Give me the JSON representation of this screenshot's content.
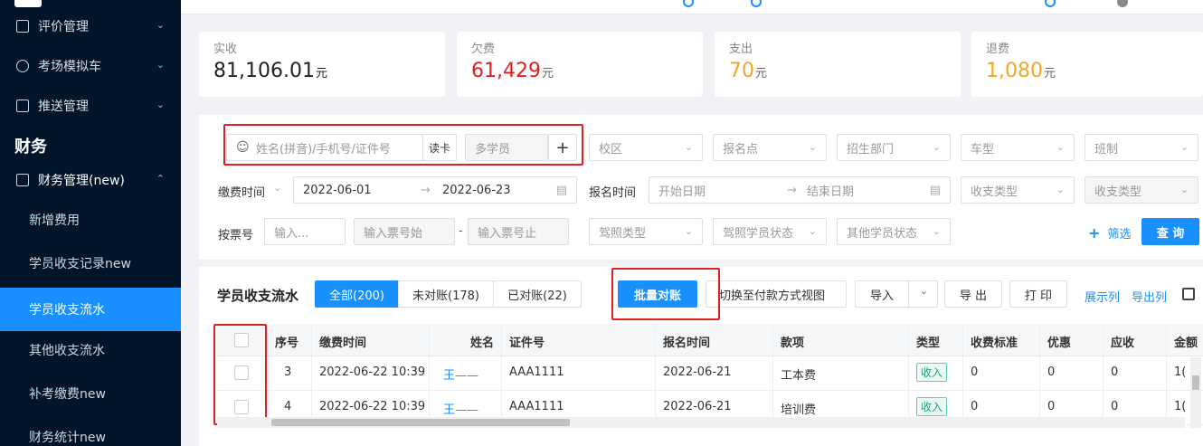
{
  "sidebar": {
    "menu": [
      {
        "label": "评价管理"
      },
      {
        "label": "考场模拟车"
      },
      {
        "label": "推送管理"
      }
    ],
    "section": "财务",
    "group": {
      "label": "财务管理(new)"
    },
    "sub": [
      {
        "label": "新增费用"
      },
      {
        "label": "学员收支记录new"
      },
      {
        "label": "学员收支流水"
      },
      {
        "label": "其他收支流水"
      },
      {
        "label": "补考缴费new"
      },
      {
        "label": "财务统计new"
      }
    ]
  },
  "stats": [
    {
      "label": "实收",
      "value": "81,106.01",
      "unit": "元",
      "color": "#222222"
    },
    {
      "label": "欠费",
      "value": "61,429",
      "unit": "元",
      "color": "#e02020"
    },
    {
      "label": "支出",
      "value": "70",
      "unit": "元",
      "color": "#f5a623"
    },
    {
      "label": "退费",
      "value": "1,080",
      "unit": "元",
      "color": "#f5a623"
    }
  ],
  "filters": {
    "search_placeholder": "姓名(拼音)/手机号/证件号",
    "read_card": "读卡",
    "multi_student": "多学员",
    "plus": "+",
    "campus": "校区",
    "signup_point": "报名点",
    "recruit_dept": "招生部门",
    "car_type": "车型",
    "class_type": "班制",
    "pay_time_label": "缴费时间",
    "pay_start": "2022-06-01",
    "pay_end": "2022-06-23",
    "signup_time_label": "报名时间",
    "signup_start": "开始日期",
    "signup_end": "结束日期",
    "income_type_1": "收支类型",
    "income_type_2": "收支类型",
    "ticket_label": "按票号",
    "ticket_input": "输入...",
    "ticket_start": "输入票号始",
    "ticket_dash": "-",
    "ticket_end": "输入票号止",
    "license_type": "驾照类型",
    "license_status": "驾照学员状态",
    "other_status": "其他学员状态",
    "filter_link": "筛选",
    "query": "查 询"
  },
  "table": {
    "title": "学员收支流水",
    "tabs": [
      {
        "label": "全部(200)"
      },
      {
        "label": "未对账(178)"
      },
      {
        "label": "已对账(22)"
      }
    ],
    "batch_reconcile": "批量对账",
    "switch_view": "切换至付款方式视图",
    "import": "导入",
    "export": "导 出",
    "print": "打 印",
    "show_cols": "展示列",
    "export_cols": "导出列",
    "columns": [
      "序号",
      "缴费时间",
      "姓名",
      "证件号",
      "报名时间",
      "款项",
      "类型",
      "收费标准",
      "优惠",
      "应收",
      "金额"
    ],
    "rows": [
      {
        "no": "3",
        "pay_time": "2022-06-22 10:39",
        "name": "王——",
        "id": "AAA1111",
        "signup": "2022-06-21",
        "item": "工本费",
        "type": "收入",
        "std": "0",
        "discount": "0",
        "due": "0",
        "amount": "1("
      },
      {
        "no": "4",
        "pay_time": "2022-06-22 10:39",
        "name": "王——",
        "id": "AAA1111",
        "signup": "2022-06-21",
        "item": "培训费",
        "type": "收入",
        "std": "0",
        "discount": "0",
        "due": "0",
        "amount": "1("
      }
    ]
  },
  "colors": {
    "primary": "#1890ff",
    "sidebar_bg": "#001529",
    "highlight": "#e02020"
  }
}
